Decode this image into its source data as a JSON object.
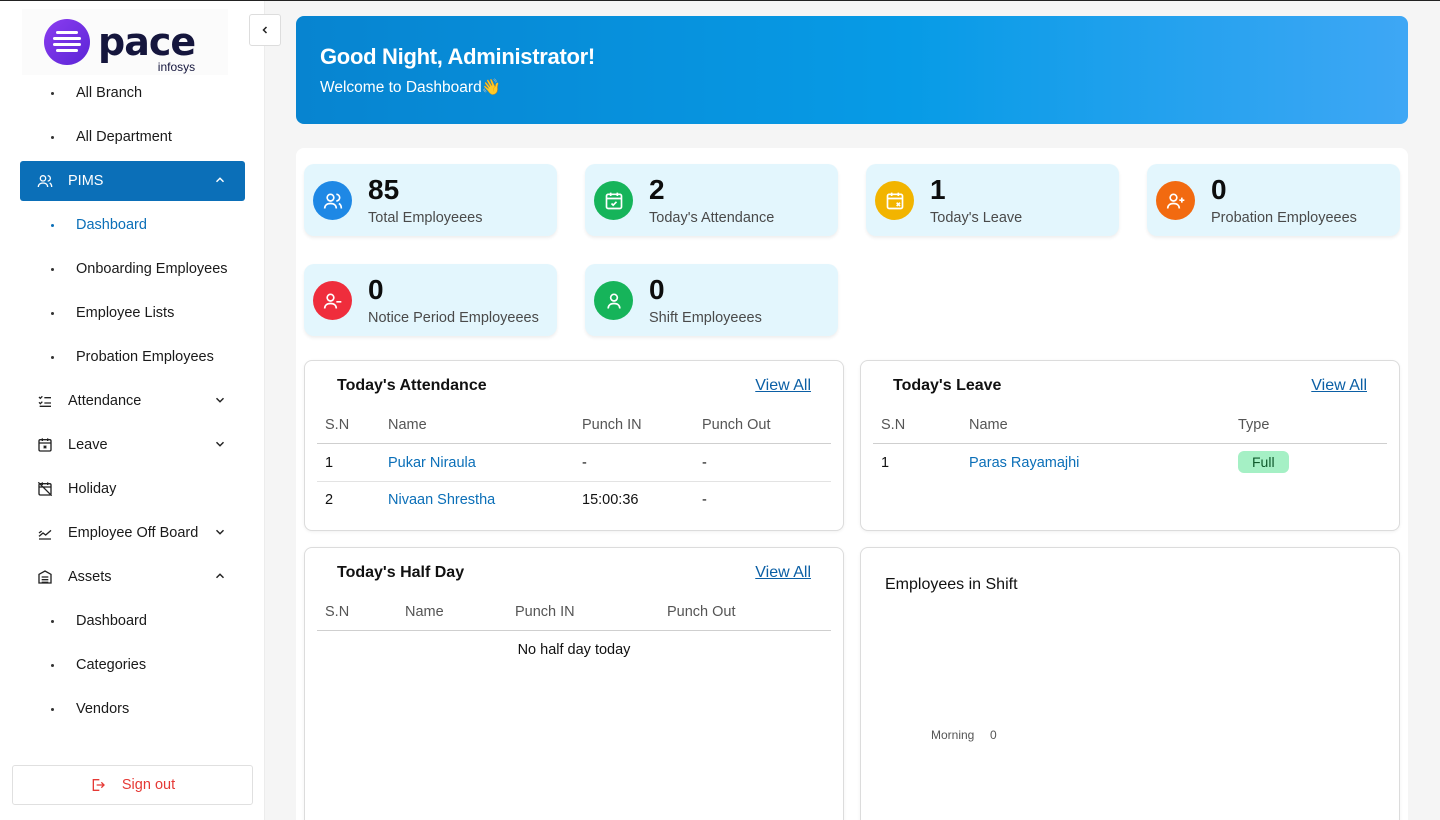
{
  "brand": {
    "name": "pace",
    "sub": "infosys"
  },
  "sidebar": {
    "top_items": [
      "All Branch",
      "All Department"
    ],
    "pims": {
      "label": "PIMS",
      "children": [
        "Dashboard",
        "Onboarding Employees",
        "Employee Lists",
        "Probation Employees"
      ]
    },
    "attendance": "Attendance",
    "leave": "Leave",
    "holiday": "Holiday",
    "offboard": "Employee Off Board",
    "assets": {
      "label": "Assets",
      "children": [
        "Dashboard",
        "Categories",
        "Vendors"
      ]
    },
    "signout": "Sign out"
  },
  "banner": {
    "greeting": "Good Night, Administrator!",
    "welcome": "Welcome to Dashboard👋"
  },
  "stats": [
    {
      "value": "85",
      "label": "Total Employeees",
      "color": "#1e88e5",
      "icon": "users-icon"
    },
    {
      "value": "2",
      "label": "Today's Attendance",
      "color": "#16b45a",
      "icon": "calendar-check-icon"
    },
    {
      "value": "1",
      "label": "Today's Leave",
      "color": "#f2b400",
      "icon": "calendar-x-icon"
    },
    {
      "value": "0",
      "label": "Probation Employeees",
      "color": "#f26a10",
      "icon": "user-plus-icon"
    },
    {
      "value": "0",
      "label": "Notice Period Employeees",
      "color": "#ef2d3c",
      "icon": "user-minus-icon"
    },
    {
      "value": "0",
      "label": "Shift Employeees",
      "color": "#16b45a",
      "icon": "user-icon"
    }
  ],
  "attendance_card": {
    "title": "Today's Attendance",
    "view_all": "View All",
    "headers": [
      "S.N",
      "Name",
      "Punch IN",
      "Punch Out"
    ],
    "rows": [
      [
        "1",
        "Pukar Niraula",
        "-",
        "-"
      ],
      [
        "2",
        "Nivaan Shrestha",
        "15:00:36",
        "-"
      ]
    ]
  },
  "leave_card": {
    "title": "Today's Leave",
    "view_all": "View All",
    "headers": [
      "S.N",
      "Name",
      "Type"
    ],
    "rows": [
      [
        "1",
        "Paras Rayamajhi",
        "Full"
      ]
    ]
  },
  "halfday_card": {
    "title": "Today's Half Day",
    "view_all": "View All",
    "headers": [
      "S.N",
      "Name",
      "Punch IN",
      "Punch Out"
    ],
    "empty": "No half day today"
  },
  "shift_card": {
    "title": "Employees in Shift",
    "shift": "Morning",
    "count": "0"
  }
}
